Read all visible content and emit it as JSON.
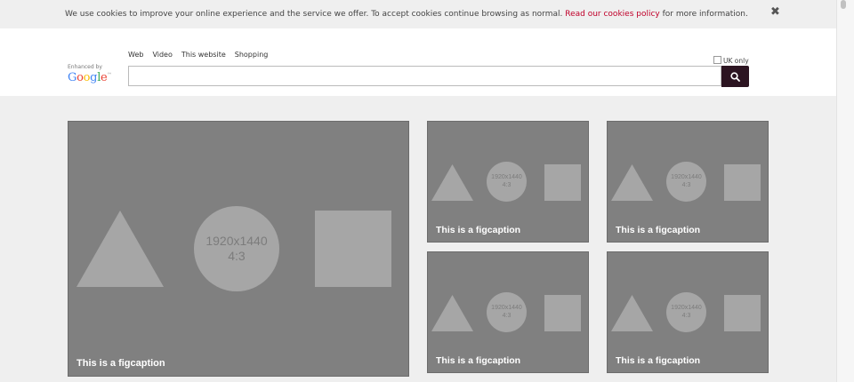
{
  "cookie_bar": {
    "text_before": "We use cookies to improve your online experience and the service we offer. To accept cookies continue browsing as normal.",
    "link_text": "Read our cookies policy",
    "text_after": "for more information.",
    "close_label": "✖"
  },
  "search": {
    "enhanced_by": "Enhanced by",
    "logo": {
      "letters": [
        {
          "ch": "G",
          "color": "#4285f4"
        },
        {
          "ch": "o",
          "color": "#ea4335"
        },
        {
          "ch": "o",
          "color": "#fbbc05"
        },
        {
          "ch": "g",
          "color": "#4285f4"
        },
        {
          "ch": "l",
          "color": "#34a853"
        },
        {
          "ch": "e",
          "color": "#ea4335"
        }
      ],
      "tm": "™"
    },
    "tabs": [
      "Web",
      "Video",
      "This website",
      "Shopping"
    ],
    "uk_only_label": "UK only",
    "input_value": "",
    "button_icon": "search-icon"
  },
  "figures": [
    {
      "placeholder_line1": "1920x1440",
      "placeholder_line2": "4:3",
      "caption": "This is a figcaption"
    },
    {
      "placeholder_line1": "1920x1440",
      "placeholder_line2": "4:3",
      "caption": "This is a figcaption"
    },
    {
      "placeholder_line1": "1920x1440",
      "placeholder_line2": "4:3",
      "caption": "This is a figcaption"
    },
    {
      "placeholder_line1": "1920x1440",
      "placeholder_line2": "4:3",
      "caption": "This is a figcaption"
    },
    {
      "placeholder_line1": "1920x1440",
      "placeholder_line2": "4:3",
      "caption": "This is a figcaption"
    }
  ],
  "colors": {
    "cookie_link": "#c0002a",
    "search_button": "#2c1421",
    "figure_bg": "#808080",
    "placeholder_shape": "#a6a6a6"
  }
}
